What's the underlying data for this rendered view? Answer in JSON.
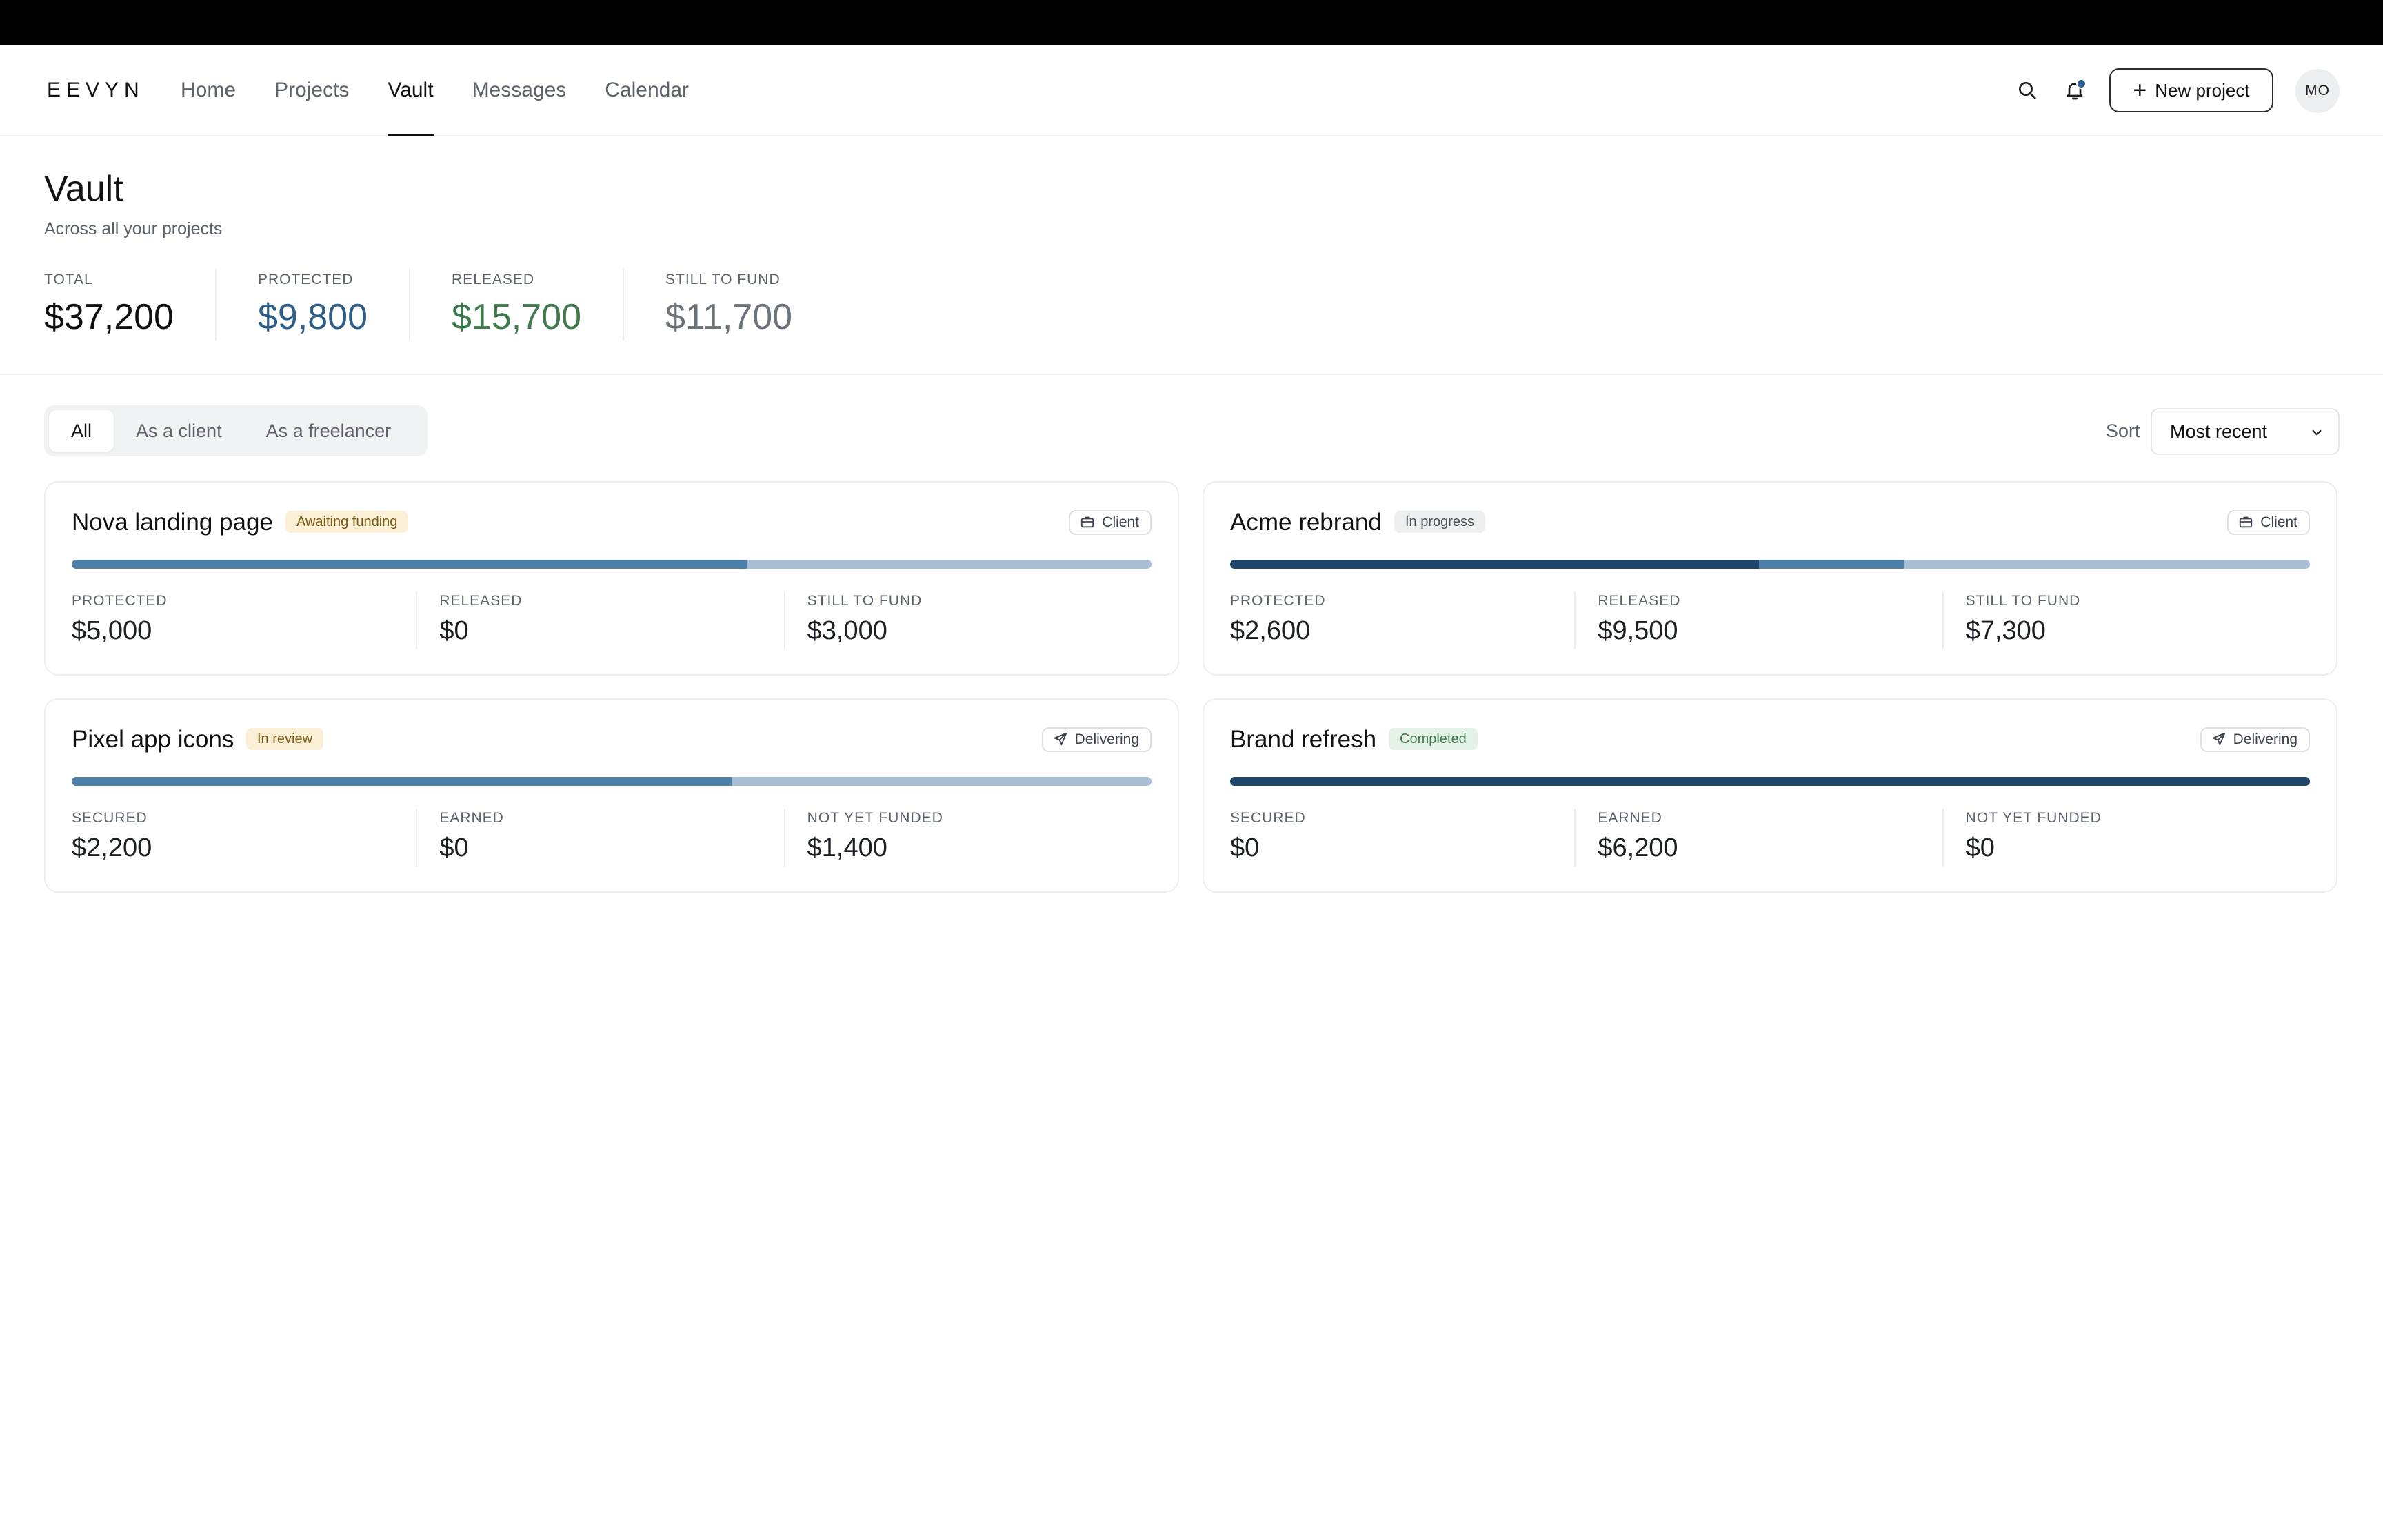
{
  "app": {
    "logo": "EEVYN"
  },
  "nav": [
    {
      "label": "Home"
    },
    {
      "label": "Projects"
    },
    {
      "label": "Vault",
      "active": true
    },
    {
      "label": "Messages"
    },
    {
      "label": "Calendar"
    }
  ],
  "header": {
    "icons": [
      "search-icon",
      "bell-icon"
    ],
    "new_project_label": "New project",
    "avatar_initials": "MO"
  },
  "page": {
    "title": "Vault",
    "subtitle": "Across all your projects"
  },
  "summary": {
    "total": {
      "label": "TOTAL",
      "value": "$37,200"
    },
    "protected": {
      "label": "PROTECTED",
      "value": "$9,800"
    },
    "released": {
      "label": "RELEASED",
      "value": "$15,700"
    },
    "still_to_fund": {
      "label": "STILL TO FUND",
      "value": "$11,700"
    }
  },
  "filters": {
    "tabs": [
      {
        "label": "All",
        "active": true
      },
      {
        "label": "As a client"
      },
      {
        "label": "As a freelancer"
      }
    ],
    "sort_label": "Sort",
    "sort_value": "Most recent"
  },
  "colors": {
    "protected": "#2e5d88",
    "released": "#3f7a4e",
    "bar_dark": "#22456a",
    "bar_mid": "#4e7fa8",
    "bar_light": "#a8bfd3"
  },
  "projects": [
    {
      "title": "Nova landing page",
      "status": "Awaiting funding",
      "status_colors": {
        "bg": "#fbf0d6",
        "fg": "#7a5a14"
      },
      "role": "Client",
      "role_icon": "briefcase-icon",
      "bar": [
        {
          "fraction": 0.625,
          "color": "#4e7fa8"
        }
      ],
      "metrics": [
        {
          "label": "PROTECTED",
          "value": "$5,000"
        },
        {
          "label": "RELEASED",
          "value": "$0"
        },
        {
          "label": "STILL TO FUND",
          "value": "$3,000"
        }
      ]
    },
    {
      "title": "Acme rebrand",
      "status": "In progress",
      "status_colors": {
        "bg": "#eeeff1",
        "fg": "#4a5058"
      },
      "role": "Client",
      "role_icon": "briefcase-icon",
      "bar": [
        {
          "fraction": 0.49,
          "color": "#22456a"
        },
        {
          "fraction": 0.134,
          "color": "#4e7fa8"
        }
      ],
      "metrics": [
        {
          "label": "PROTECTED",
          "value": "$2,600"
        },
        {
          "label": "RELEASED",
          "value": "$9,500"
        },
        {
          "label": "STILL TO FUND",
          "value": "$7,300"
        }
      ]
    },
    {
      "title": "Pixel app icons",
      "status": "In review",
      "status_colors": {
        "bg": "#fbf0d6",
        "fg": "#7a5a14"
      },
      "role": "Delivering",
      "role_icon": "send-icon",
      "bar": [
        {
          "fraction": 0.611,
          "color": "#4e7fa8"
        }
      ],
      "metrics": [
        {
          "label": "SECURED",
          "value": "$2,200"
        },
        {
          "label": "EARNED",
          "value": "$0"
        },
        {
          "label": "NOT YET FUNDED",
          "value": "$1,400"
        }
      ]
    },
    {
      "title": "Brand refresh",
      "status": "Completed",
      "status_colors": {
        "bg": "#e4f2e7",
        "fg": "#3f7a4e"
      },
      "role": "Delivering",
      "role_icon": "send-icon",
      "bar": [
        {
          "fraction": 1.0,
          "color": "#22456a"
        }
      ],
      "metrics": [
        {
          "label": "SECURED",
          "value": "$0"
        },
        {
          "label": "EARNED",
          "value": "$6,200"
        },
        {
          "label": "NOT YET FUNDED",
          "value": "$0"
        }
      ]
    }
  ]
}
